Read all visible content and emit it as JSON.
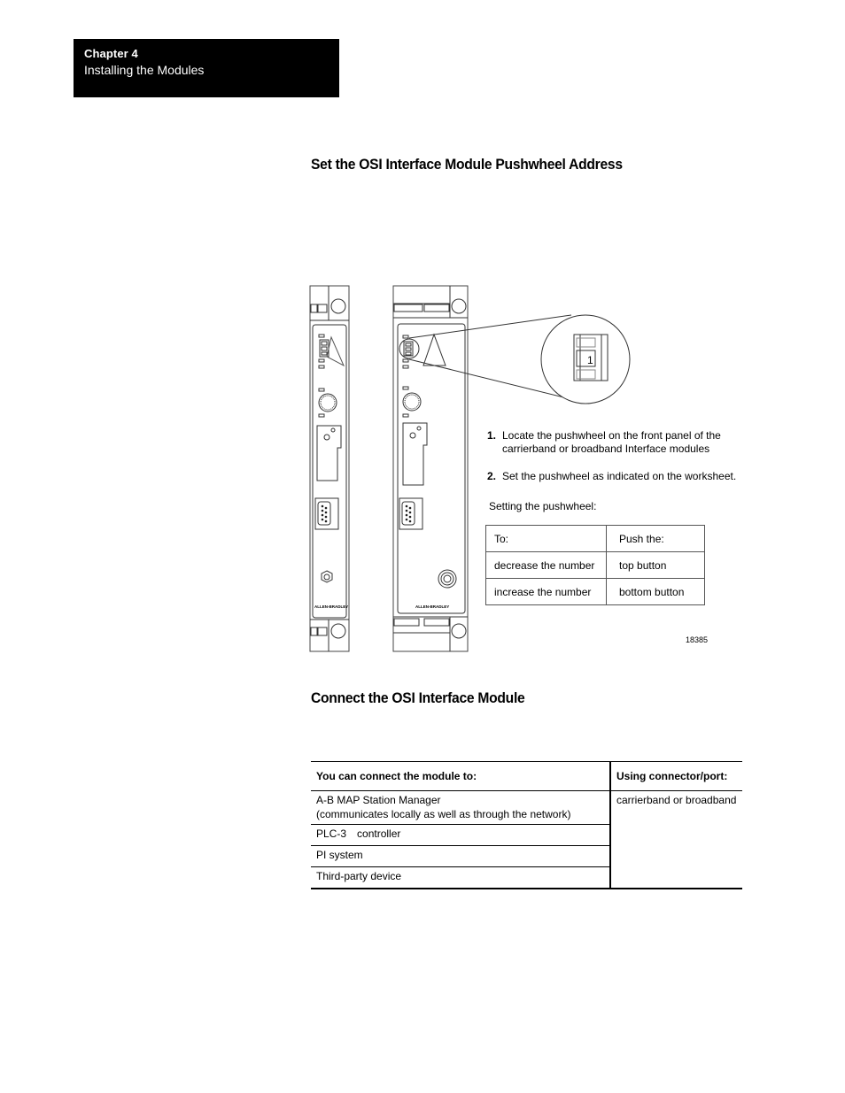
{
  "header": {
    "chapter_label": "Chapter  4",
    "chapter_title": "Installing the Modules"
  },
  "section1": {
    "heading": "Set the OSI Interface Module Pushwheel Address",
    "figure": {
      "brand_label_left": "ALLEN-BRADLEY",
      "brand_label_right": "ALLEN-BRADLEY",
      "pushwheel_digit": "1",
      "figure_number": "18385"
    },
    "steps": [
      {
        "num": "1.",
        "text": "Locate the pushwheel on the front panel of the carrierband or broadband Interface modules"
      },
      {
        "num": "2.",
        "text": "Set the pushwheel as indicated on the worksheet."
      }
    ],
    "setting_label": "Setting the pushwheel:",
    "push_table": {
      "headers": [
        "To:",
        "Push the:"
      ],
      "rows": [
        [
          "decrease the number",
          "top button"
        ],
        [
          "increase the number",
          "bottom button"
        ]
      ]
    }
  },
  "section2": {
    "heading": "Connect the OSI Interface Module",
    "connect_table": {
      "headers": [
        "You can connect the module to:",
        "Using connector/port:"
      ],
      "rows": [
        {
          "device_line1": "A-B MAP Station Manager",
          "device_line2": "(communicates locally as well as through the network)"
        },
        {
          "device_line1": "PLC-3 controller"
        },
        {
          "device_line1": "PI system"
        },
        {
          "device_line1": "Third-party device"
        }
      ],
      "port": "carrierband or broadband"
    }
  }
}
